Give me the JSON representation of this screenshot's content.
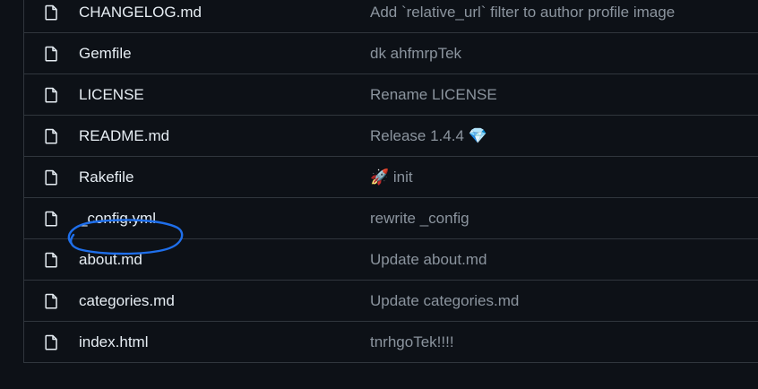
{
  "files": [
    {
      "name": "CHANGELOG.md",
      "message": "Add `relative_url` filter to author profile image"
    },
    {
      "name": "Gemfile",
      "message": "dk ahfmrpTek"
    },
    {
      "name": "LICENSE",
      "message": "Rename LICENSE"
    },
    {
      "name": "README.md",
      "message": "Release 1.4.4 💎"
    },
    {
      "name": "Rakefile",
      "message": "🚀 init"
    },
    {
      "name": "_config.yml",
      "message": "rewrite _config"
    },
    {
      "name": "about.md",
      "message": "Update about.md"
    },
    {
      "name": "categories.md",
      "message": "Update categories.md"
    },
    {
      "name": "index.html",
      "message": "tnrhgoTek!!!!"
    }
  ],
  "icon": "file-icon",
  "colors": {
    "background": "#0d1117",
    "border": "#30363d",
    "file_name": "#e6edf3",
    "commit_message": "#8b949e",
    "annotation": "#1f6feb"
  }
}
